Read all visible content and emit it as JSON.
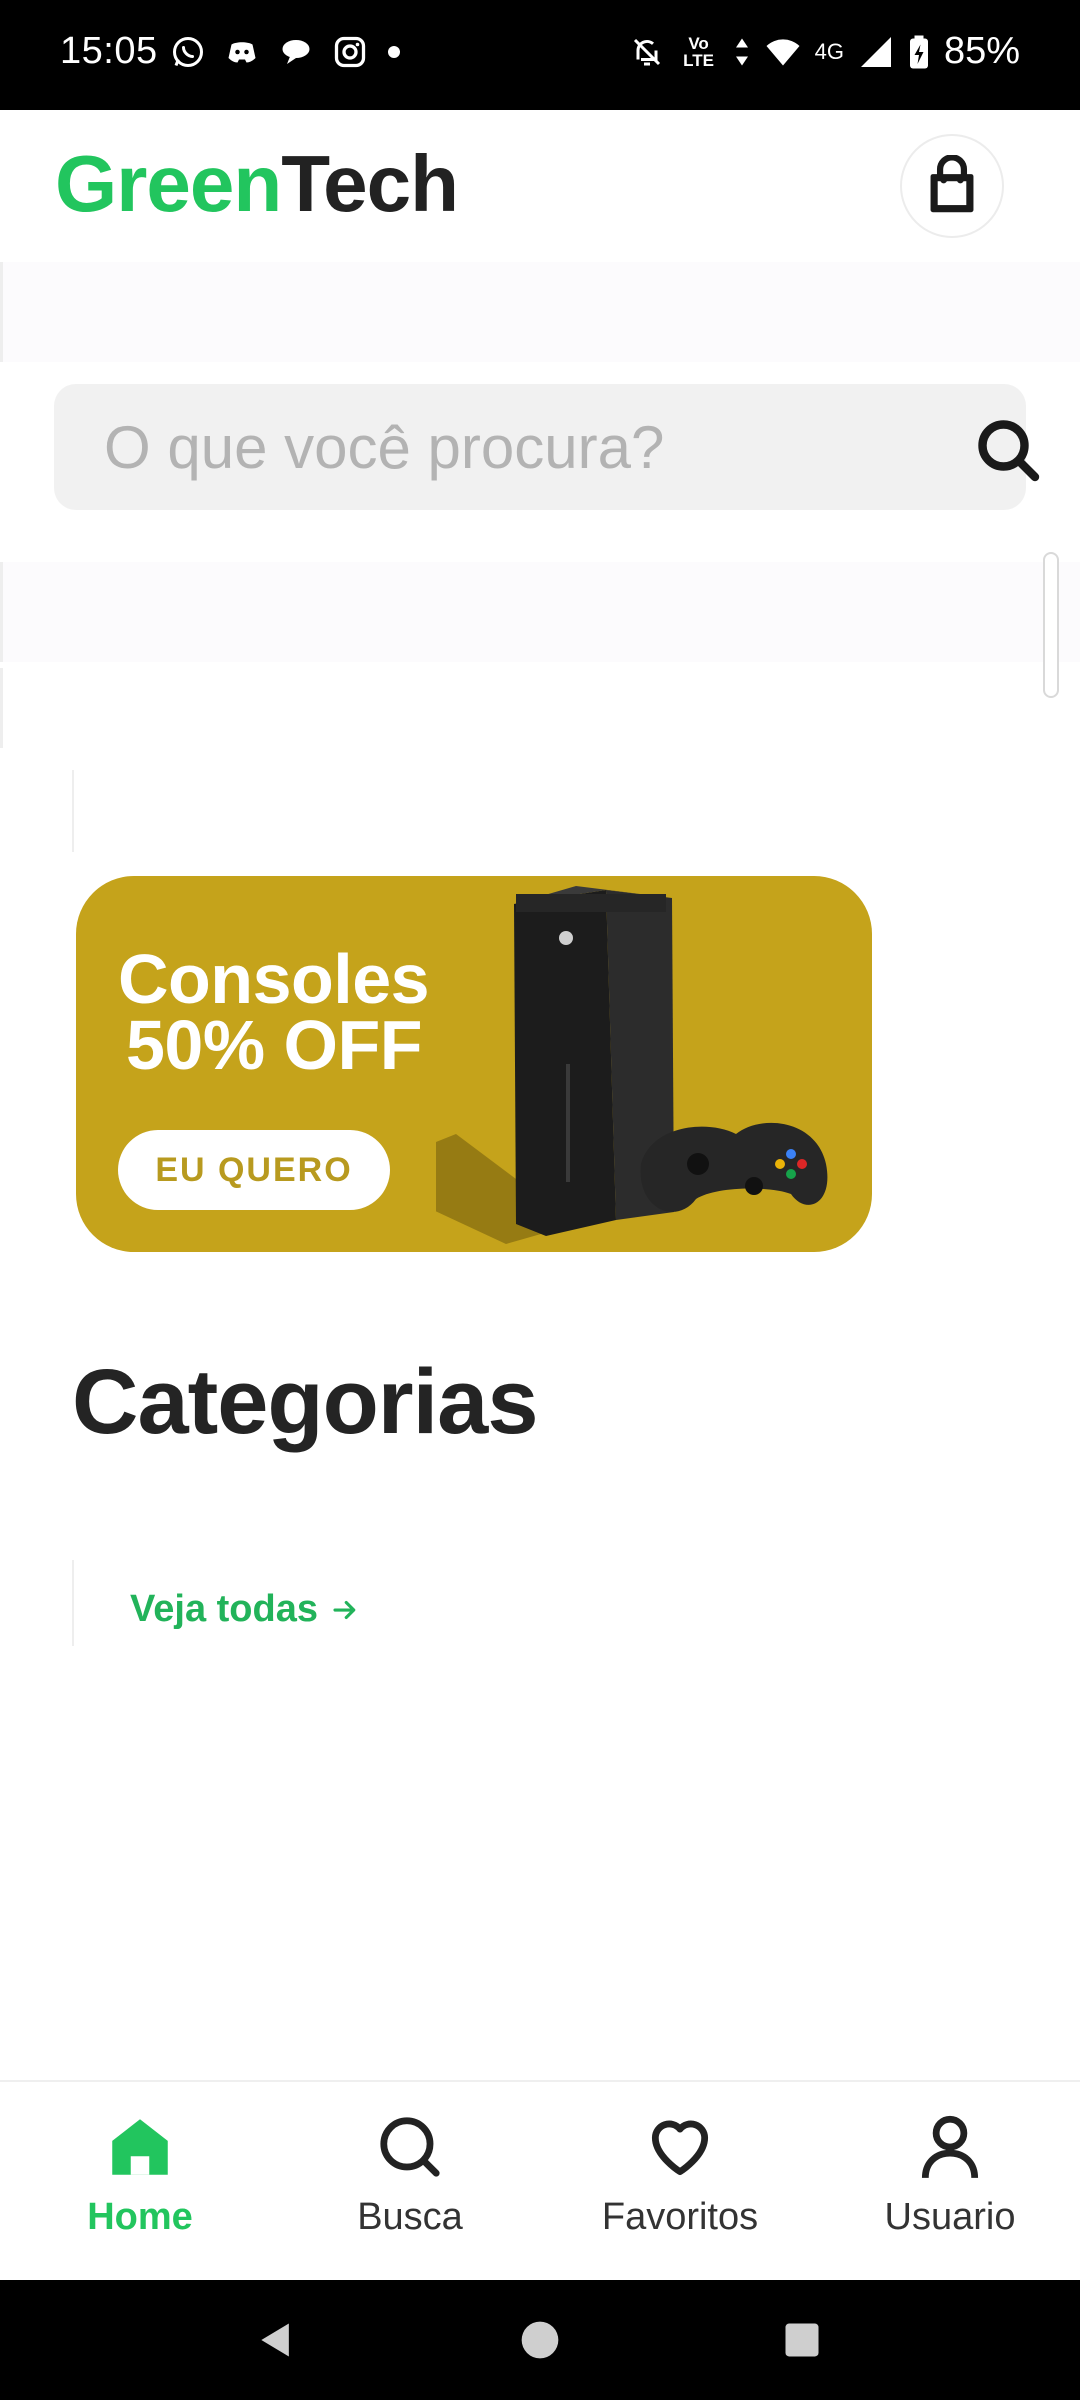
{
  "status_bar": {
    "time": "15:05",
    "battery": "85%",
    "network": "4G",
    "volte": "Vo LTE",
    "left_icons": [
      "whatsapp-icon",
      "discord-icon",
      "chat-bubble-icon",
      "instagram-icon",
      "dot-icon"
    ],
    "right_icons": [
      "bell-off-icon",
      "volte-icon",
      "data-arrows-icon",
      "wifi-icon",
      "signal-icon",
      "battery-icon"
    ]
  },
  "header": {
    "logo_part1": "Green",
    "logo_part2": "Tech",
    "cart_icon": "shopping-bag-icon"
  },
  "search": {
    "placeholder": "O que você procura?",
    "value": ""
  },
  "banner": {
    "title_line1": "Consoles",
    "title_line2": "50% OFF",
    "cta_label": "EU QUERO",
    "background_color": "#c5a31b"
  },
  "categories": {
    "title": "Categorias",
    "see_all_label": "Veja todas",
    "see_all_icon": "arrow-right-icon"
  },
  "bottom_nav": {
    "items": [
      {
        "label": "Home",
        "icon": "home-icon",
        "active": true
      },
      {
        "label": "Busca",
        "icon": "search-icon",
        "active": false
      },
      {
        "label": "Favoritos",
        "icon": "heart-icon",
        "active": false
      },
      {
        "label": "Usuario",
        "icon": "user-icon",
        "active": false
      }
    ]
  },
  "colors": {
    "accent": "#22c55e",
    "text_dark": "#242424"
  }
}
